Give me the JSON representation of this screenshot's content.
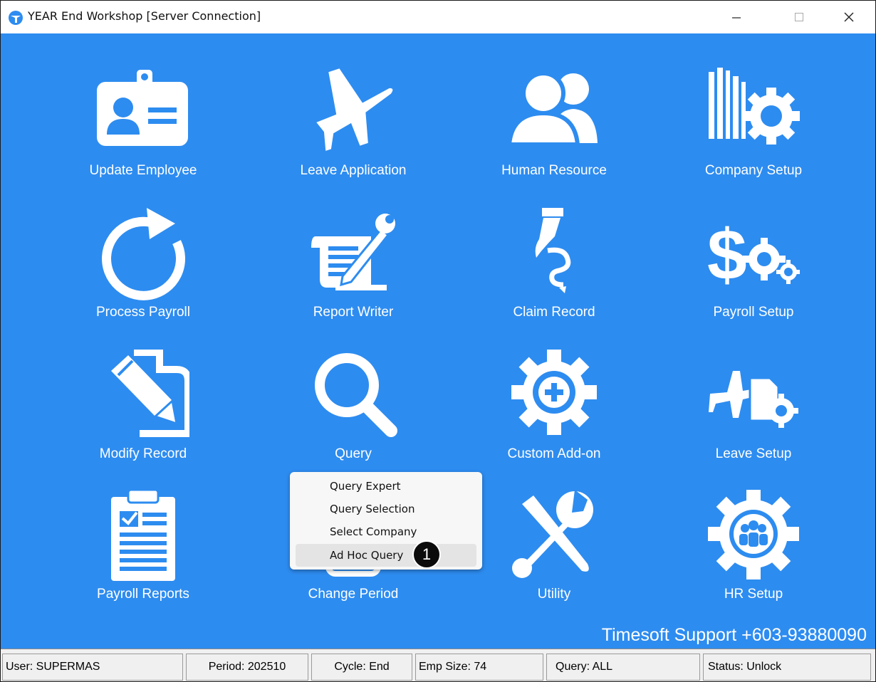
{
  "window": {
    "title": "YEAR End Workshop [Server Connection]"
  },
  "tiles": [
    {
      "label": "Update Employee",
      "icon": "id-badge-icon"
    },
    {
      "label": "Leave Application",
      "icon": "airplane-icon"
    },
    {
      "label": "Human Resource",
      "icon": "users-icon"
    },
    {
      "label": "Company Setup",
      "icon": "building-gear-icon"
    },
    {
      "label": "Process Payroll",
      "icon": "refresh-icon"
    },
    {
      "label": "Report Writer",
      "icon": "report-edit-icon"
    },
    {
      "label": "Claim Record",
      "icon": "claim-hand-icon"
    },
    {
      "label": "Payroll Setup",
      "icon": "dollar-gears-icon"
    },
    {
      "label": "Modify Record",
      "icon": "edit-file-icon"
    },
    {
      "label": "Query",
      "icon": "search-icon"
    },
    {
      "label": "Custom Add-on",
      "icon": "gear-plus-icon"
    },
    {
      "label": "Leave Setup",
      "icon": "plane-document-gear-icon"
    },
    {
      "label": "Payroll Reports",
      "icon": "clipboard-report-icon"
    },
    {
      "label": "Change Period",
      "icon": "calendar-icon"
    },
    {
      "label": "Utility",
      "icon": "tools-icon"
    },
    {
      "label": "HR Setup",
      "icon": "team-gear-icon"
    }
  ],
  "context_menu": {
    "items": [
      "Query Expert",
      "Query Selection",
      "Select Company",
      "Ad Hoc Query"
    ],
    "highlighted": "Ad Hoc Query",
    "callout_number": "1"
  },
  "support_text": "Timesoft Support +603-93880090",
  "status": {
    "user": "User: SUPERMAS",
    "period": "Period: 202510",
    "cycle": "Cycle: End",
    "emp_size": "Emp Size: 74",
    "query": "Query: ALL",
    "state": "Status: Unlock"
  },
  "colors": {
    "background": "#2d8cf0",
    "icon": "#ffffff"
  }
}
